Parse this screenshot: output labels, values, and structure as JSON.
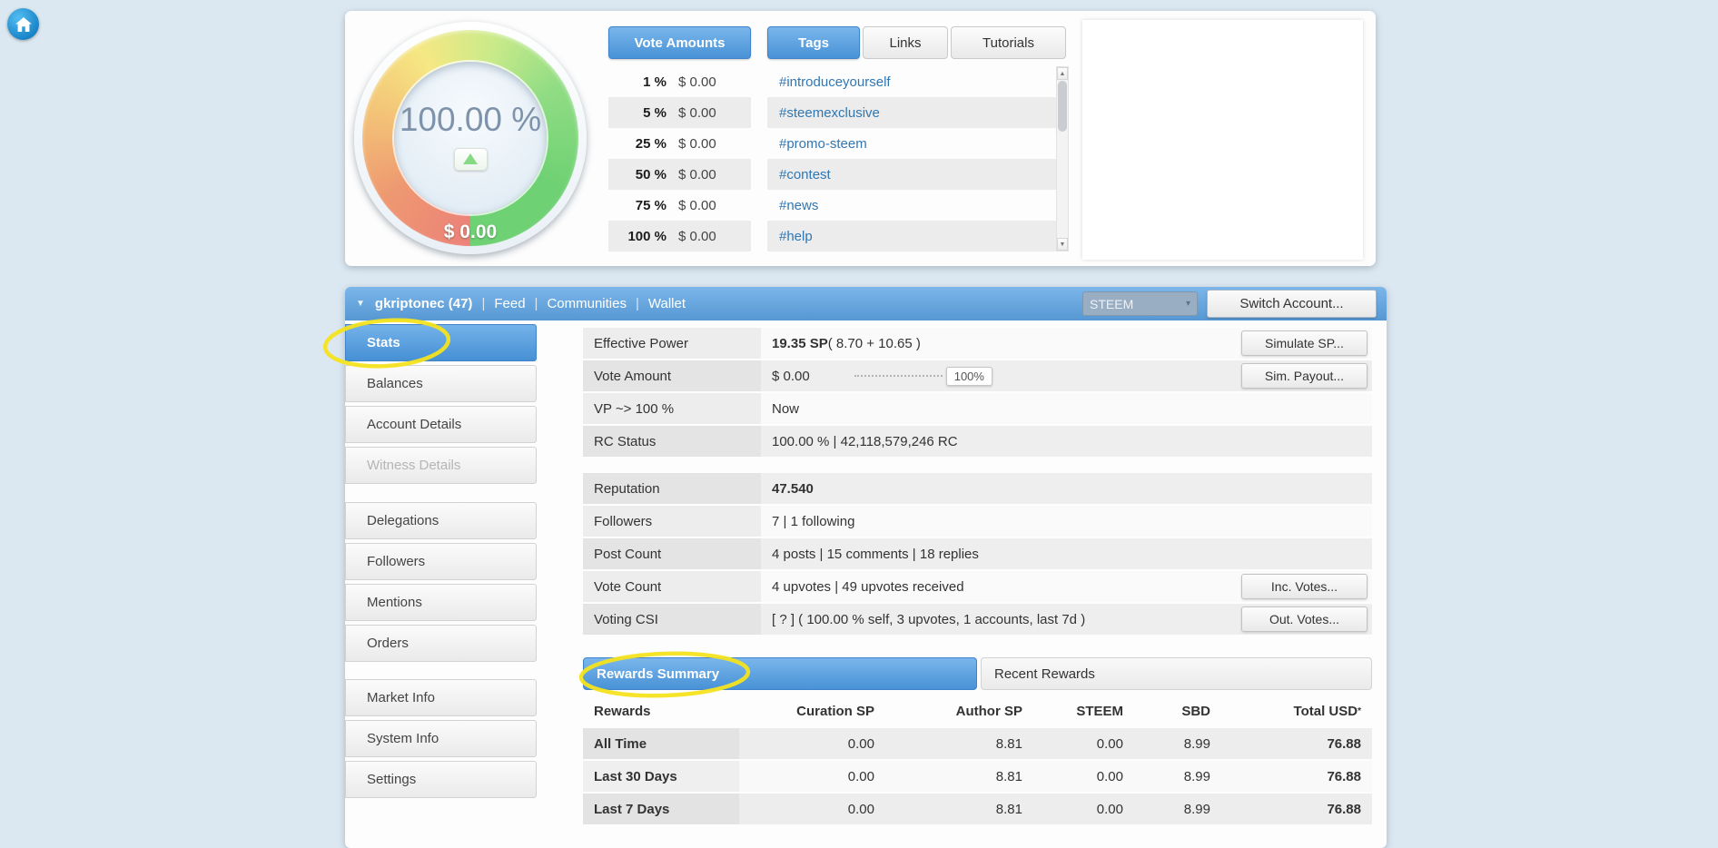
{
  "icons": {
    "caret_down": "▼",
    "select_caret": "▾",
    "scroll_up": "▲",
    "scroll_down": "▼"
  },
  "gauge": {
    "percent": "100.00 %",
    "amount": "$ 0.00"
  },
  "vote_amounts": {
    "title": "Vote Amounts",
    "rows": [
      {
        "p": "1 %",
        "v": "$ 0.00"
      },
      {
        "p": "5 %",
        "v": "$ 0.00"
      },
      {
        "p": "25 %",
        "v": "$ 0.00"
      },
      {
        "p": "50 %",
        "v": "$ 0.00"
      },
      {
        "p": "75 %",
        "v": "$ 0.00"
      },
      {
        "p": "100 %",
        "v": "$ 0.00"
      }
    ]
  },
  "tags_panel": {
    "tabs": [
      {
        "label": "Tags"
      },
      {
        "label": "Links"
      },
      {
        "label": "Tutorials"
      }
    ],
    "tags": [
      "#introduceyourself",
      "#steemexclusive",
      "#promo-steem",
      "#contest",
      "#news",
      "#help"
    ]
  },
  "account_bar": {
    "account": "gkriptonec (47)",
    "sep": "|",
    "links": [
      "Feed",
      "Communities",
      "Wallet"
    ],
    "chain": "STEEM",
    "switch_label": "Switch Account..."
  },
  "sidebar": {
    "items": [
      "Stats",
      "Balances",
      "Account Details",
      "Witness Details",
      "Delegations",
      "Followers",
      "Mentions",
      "Orders",
      "Market Info",
      "System Info",
      "Settings"
    ]
  },
  "stats": {
    "slider": "100%",
    "rows": [
      {
        "label": "Effective Power",
        "strong": "19.35 SP",
        "text": " ( 8.70 + 10.65 )"
      },
      {
        "label": "Vote Amount",
        "text": "$ 0.00"
      },
      {
        "label": "VP ~> 100 %",
        "text": "Now"
      },
      {
        "label": "RC Status",
        "text": "100.00 % | 42,118,579,246 RC"
      },
      {
        "label": "Reputation",
        "strong": "47.540"
      },
      {
        "label": "Followers",
        "text": "7 | 1 following"
      },
      {
        "label": "Post Count",
        "text": "4 posts | 15 comments | 18 replies"
      },
      {
        "label": "Vote Count",
        "text": "4 upvotes | 49 upvotes received"
      },
      {
        "label": "Voting CSI",
        "text": "[ ? ] ( 100.00 % self, 3 upvotes, 1 accounts, last 7d )"
      }
    ],
    "buttons": {
      "simulate": "Simulate SP...",
      "payout": "Sim. Payout...",
      "inc": "Inc. Votes...",
      "out": "Out. Votes..."
    }
  },
  "rewards": {
    "tabs": [
      {
        "label": "Rewards Summary"
      },
      {
        "label": "Recent Rewards"
      }
    ],
    "headers": [
      "Rewards",
      "Curation SP",
      "Author SP",
      "STEEM",
      "SBD",
      "Total USD"
    ],
    "total_note": "*",
    "rows": [
      {
        "name": "All Time",
        "curation": "0.00",
        "author": "8.81",
        "steem": "0.00",
        "sbd": "8.99",
        "total": "76.88"
      },
      {
        "name": "Last 30 Days",
        "curation": "0.00",
        "author": "8.81",
        "steem": "0.00",
        "sbd": "8.99",
        "total": "76.88"
      },
      {
        "name": "Last 7 Days",
        "curation": "0.00",
        "author": "8.81",
        "steem": "0.00",
        "sbd": "8.99",
        "total": "76.88"
      }
    ]
  }
}
